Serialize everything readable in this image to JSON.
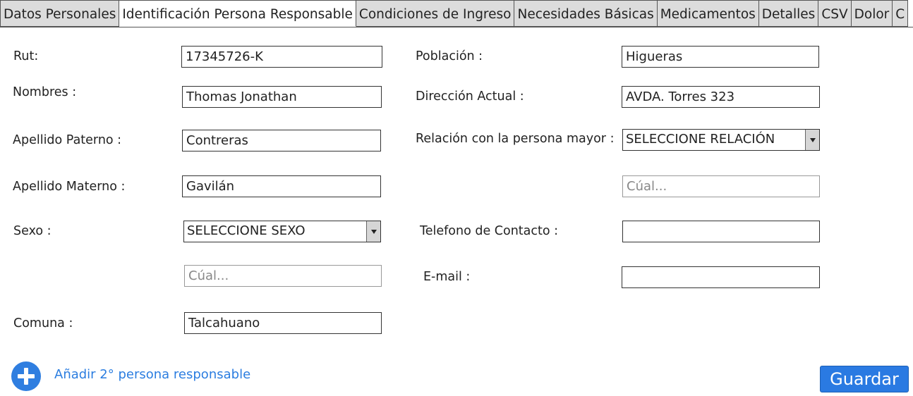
{
  "tabs": [
    {
      "label": "Datos Personales",
      "active": false
    },
    {
      "label": "Identificación Persona Responsable",
      "active": true
    },
    {
      "label": "Condiciones de Ingreso",
      "active": false
    },
    {
      "label": "Necesidades Básicas",
      "active": false
    },
    {
      "label": "Medicamentos",
      "active": false
    },
    {
      "label": "Detalles",
      "active": false
    },
    {
      "label": "CSV",
      "active": false
    },
    {
      "label": "Dolor",
      "active": false
    },
    {
      "label": "C",
      "active": false
    }
  ],
  "form": {
    "rut": {
      "label": "Rut:",
      "value": "17345726-K"
    },
    "nombres": {
      "label": "Nombres :",
      "value": "Thomas Jonathan"
    },
    "apellido_paterno": {
      "label": "Apellido Paterno :",
      "value": "Contreras"
    },
    "apellido_materno": {
      "label": "Apellido Materno :",
      "value": "Gavilán"
    },
    "sexo": {
      "label": "Sexo :",
      "selected": "SELECCIONE SEXO",
      "other_placeholder": "Cúal..."
    },
    "comuna": {
      "label": "Comuna :",
      "value": "Talcahuano"
    },
    "poblacion": {
      "label": "Población :",
      "value": "Higueras"
    },
    "direccion": {
      "label": "Dirección Actual :",
      "value": "AVDA. Torres 323"
    },
    "relacion": {
      "label": "Relación con la persona mayor :",
      "selected": "SELECCIONE RELACIÓN",
      "other_placeholder": "Cúal..."
    },
    "telefono": {
      "label": "Telefono de Contacto :",
      "value": ""
    },
    "email": {
      "label": "E-mail :",
      "value": ""
    }
  },
  "actions": {
    "add_label": "Añadir 2° persona responsable",
    "save_label": "Guardar"
  },
  "colors": {
    "accent": "#2a7ae2",
    "tab_inactive": "#dcdcdc"
  }
}
